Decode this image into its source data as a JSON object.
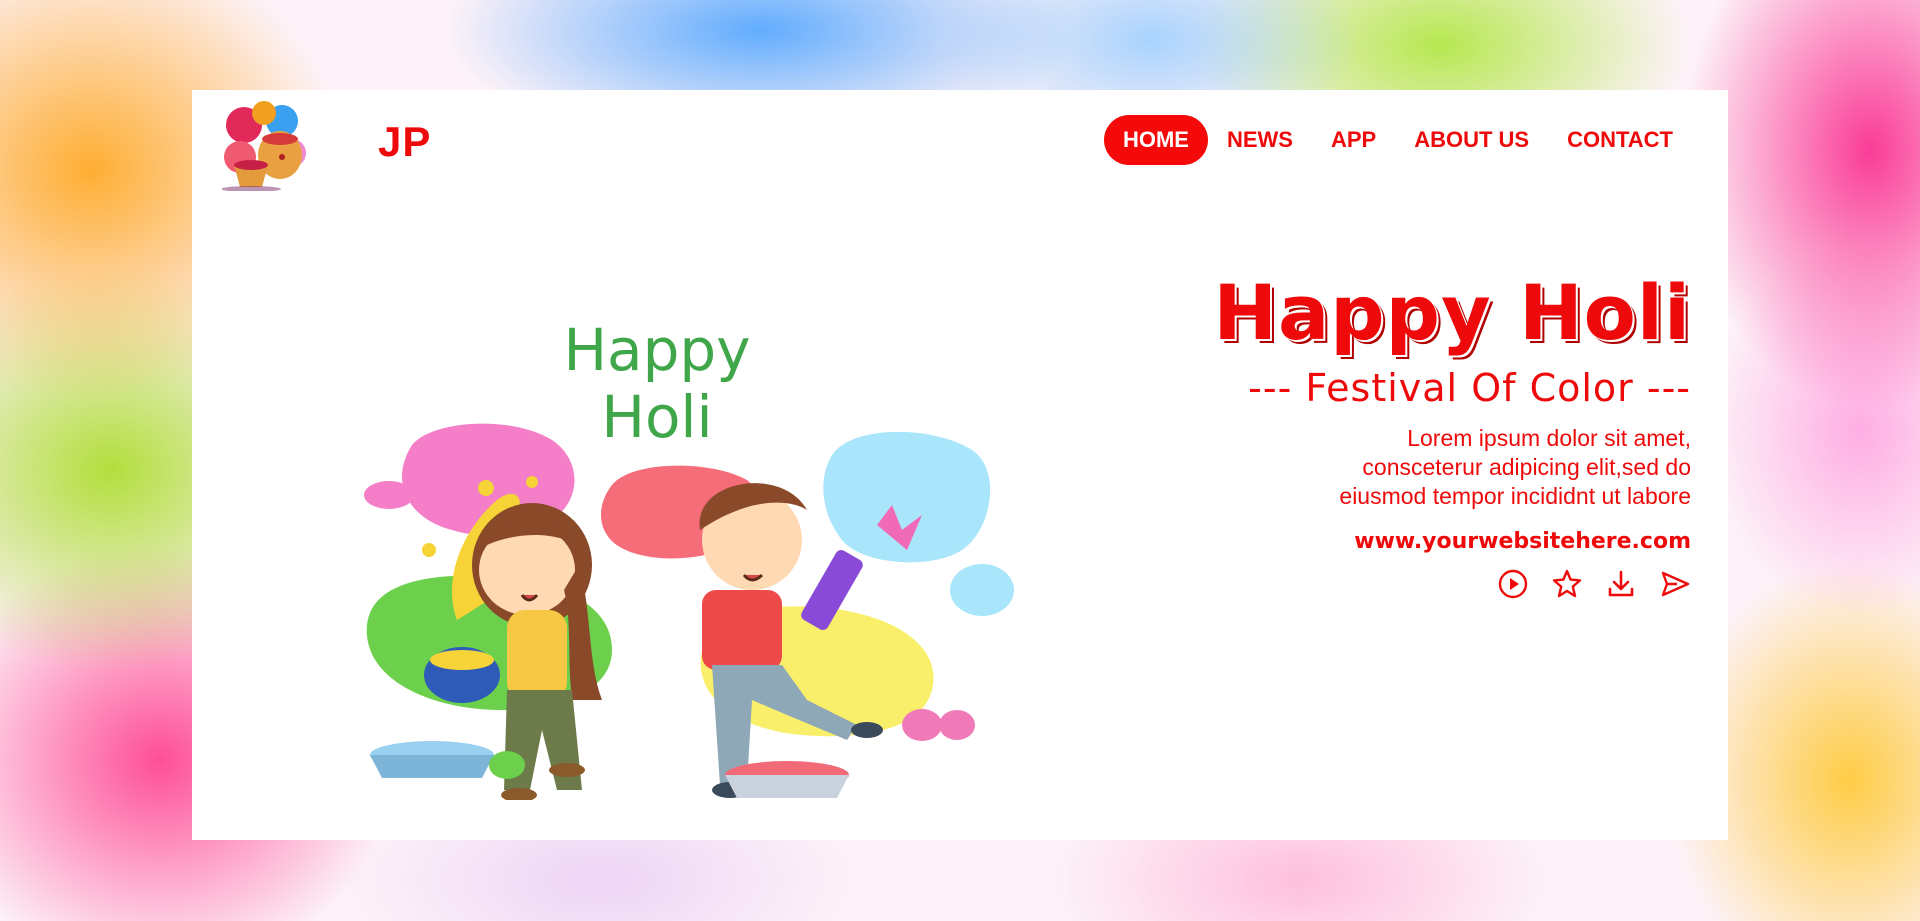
{
  "brand": {
    "name": "JP",
    "logo_icon": "color-pots-logo-icon"
  },
  "nav": {
    "items": [
      {
        "label": "HOME",
        "active": true
      },
      {
        "label": "NEWS",
        "active": false
      },
      {
        "label": "APP",
        "active": false
      },
      {
        "label": "ABOUT US",
        "active": false
      },
      {
        "label": "CONTACT",
        "active": false
      }
    ]
  },
  "illustration": {
    "heading_line1": "Happy",
    "heading_line2": "Holi"
  },
  "hero": {
    "title": "Happy Holi",
    "subtitle": "--- Festival Of Color ---",
    "body_lines": [
      "Lorem ipsum dolor sit amet,",
      "consceterur adipicing elit,sed do",
      "eiusmod tempor incididnt ut labore"
    ],
    "url": "www.yourwebsitehere.com"
  },
  "actions": [
    {
      "icon": "play-circle-icon"
    },
    {
      "icon": "star-icon"
    },
    {
      "icon": "download-icon"
    },
    {
      "icon": "send-icon"
    }
  ],
  "colors": {
    "accent": "#ee0a0a",
    "background": "#ffffff"
  }
}
